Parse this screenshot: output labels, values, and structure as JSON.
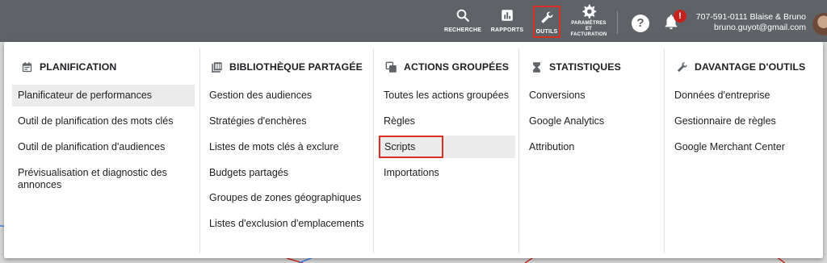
{
  "topbar": {
    "search_label": "RECHERCHE",
    "reports_label": "RAPPORTS",
    "tools_label": "OUTILS",
    "settings_label_line1": "PARAMÈTRES",
    "settings_label_line2": "ET",
    "settings_label_line3": "FACTURATION",
    "help_glyph": "?",
    "alert_glyph": "!",
    "account_line1": "707-591-0111 Blaise & Bruno",
    "account_line2": "bruno.guyot@gmail.com"
  },
  "menu": {
    "columns": [
      {
        "title": "PLANIFICATION",
        "icon": "calendar-icon",
        "items": [
          {
            "label": "Planificateur de performances"
          },
          {
            "label": "Outil de planification des mots clés"
          },
          {
            "label": "Outil de planification d'audiences"
          },
          {
            "label": "Prévisualisation et diagnostic des annonces"
          }
        ]
      },
      {
        "title": "BIBLIOTHÈQUE PARTAGÉE",
        "icon": "library-icon",
        "items": [
          {
            "label": "Gestion des audiences"
          },
          {
            "label": "Stratégies d'enchères"
          },
          {
            "label": "Listes de mots clés à exclure"
          },
          {
            "label": "Budgets partagés"
          },
          {
            "label": "Groupes de zones géographiques"
          },
          {
            "label": "Listes d'exclusion d'emplacements"
          }
        ]
      },
      {
        "title": "ACTIONS GROUPÉES",
        "icon": "copy-icon",
        "items": [
          {
            "label": "Toutes les actions groupées"
          },
          {
            "label": "Règles"
          },
          {
            "label": "Scripts"
          },
          {
            "label": "Importations"
          }
        ]
      },
      {
        "title": "STATISTIQUES",
        "icon": "hourglass-icon",
        "items": [
          {
            "label": "Conversions"
          },
          {
            "label": "Google Analytics"
          },
          {
            "label": "Attribution"
          }
        ]
      },
      {
        "title": "DAVANTAGE D'OUTILS",
        "icon": "wrench-icon",
        "items": [
          {
            "label": "Données d'entreprise"
          },
          {
            "label": "Gestionnaire de règles"
          },
          {
            "label": "Google Merchant Center"
          }
        ]
      }
    ]
  },
  "colors": {
    "topbar": "#5f6368",
    "highlight_box": "#d93025",
    "selected_row": "#ececec",
    "alert": "#c5221f"
  }
}
